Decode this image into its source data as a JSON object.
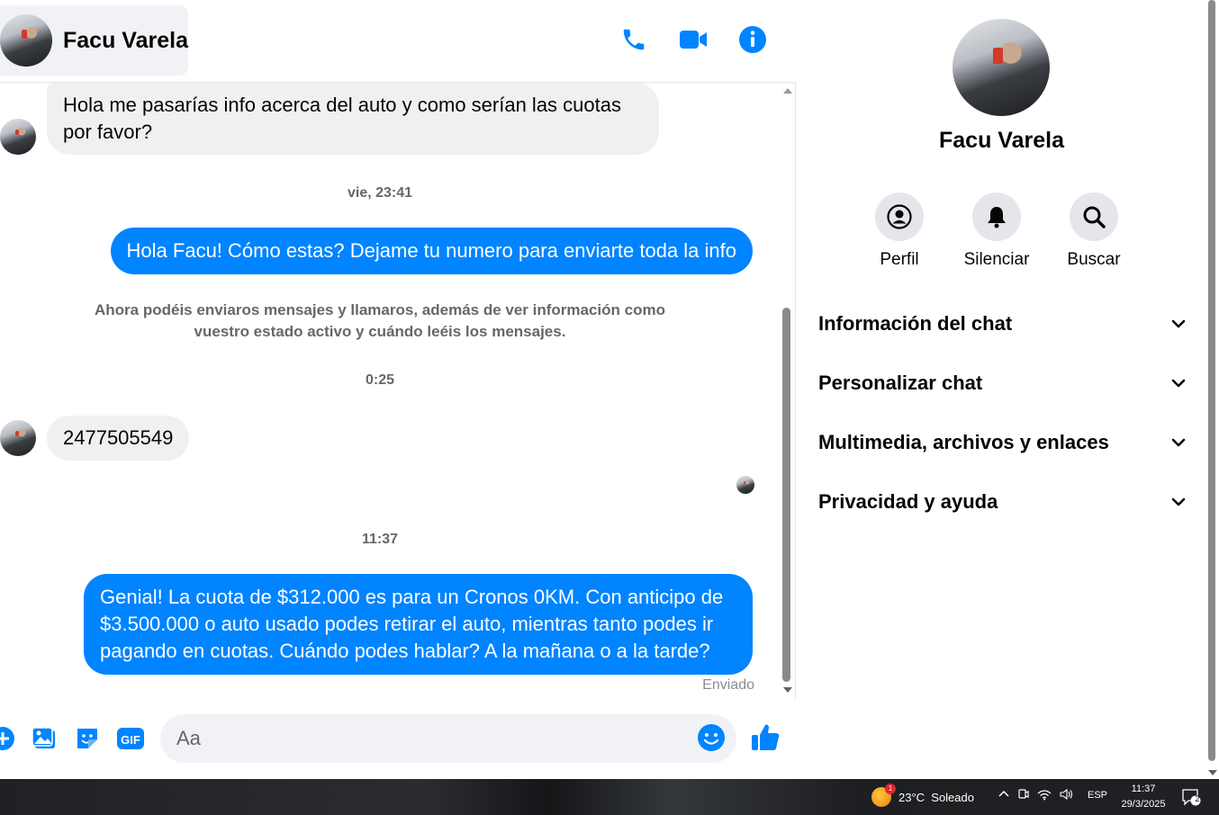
{
  "header": {
    "contact_name": "Facu Varela"
  },
  "icons": {
    "call": "phone-icon",
    "video": "video-camera-icon",
    "info": "info-icon"
  },
  "colors": {
    "accent": "#0084ff",
    "incoming_bubble": "#f0f0f0",
    "muted_text": "#65676b"
  },
  "conversation": {
    "msg1": "Hola me pasarías info acerca del auto y como serían las cuotas por favor?",
    "time1": "vie, 23:41",
    "msg2": "Hola Facu! Cómo estas? Dejame tu numero para enviarte toda la info",
    "system_note": "Ahora podéis enviaros mensajes y llamaros, además de ver información como vuestro estado activo y cuándo leéis los mensajes.",
    "time2": "0:25",
    "msg3": "2477505549",
    "time3": "11:37",
    "msg4": "Genial! La cuota de $312.000 es para un Cronos 0KM. Con anticipo de $3.500.000 o auto usado podes retirar el auto, mientras tanto podes ir pagando en cuotas. Cuándo podes hablar? A la mañana o a la tarde?",
    "status": "Enviado"
  },
  "composer": {
    "placeholder": "Aa"
  },
  "info_panel": {
    "name": "Facu Varela",
    "actions": [
      {
        "label": "Perfil",
        "icon": "profile-icon"
      },
      {
        "label": "Silenciar",
        "icon": "bell-icon"
      },
      {
        "label": "Buscar",
        "icon": "search-icon"
      }
    ],
    "sections": [
      {
        "label": "Información del chat"
      },
      {
        "label": "Personalizar chat"
      },
      {
        "label": "Multimedia, archivos y enlaces"
      },
      {
        "label": "Privacidad y ayuda"
      }
    ]
  },
  "taskbar": {
    "weather_badge": "1",
    "weather": "23°C  Soleado",
    "language": "ESP",
    "time": "11:37",
    "date": "29/3/2025",
    "notification_count": "2"
  }
}
